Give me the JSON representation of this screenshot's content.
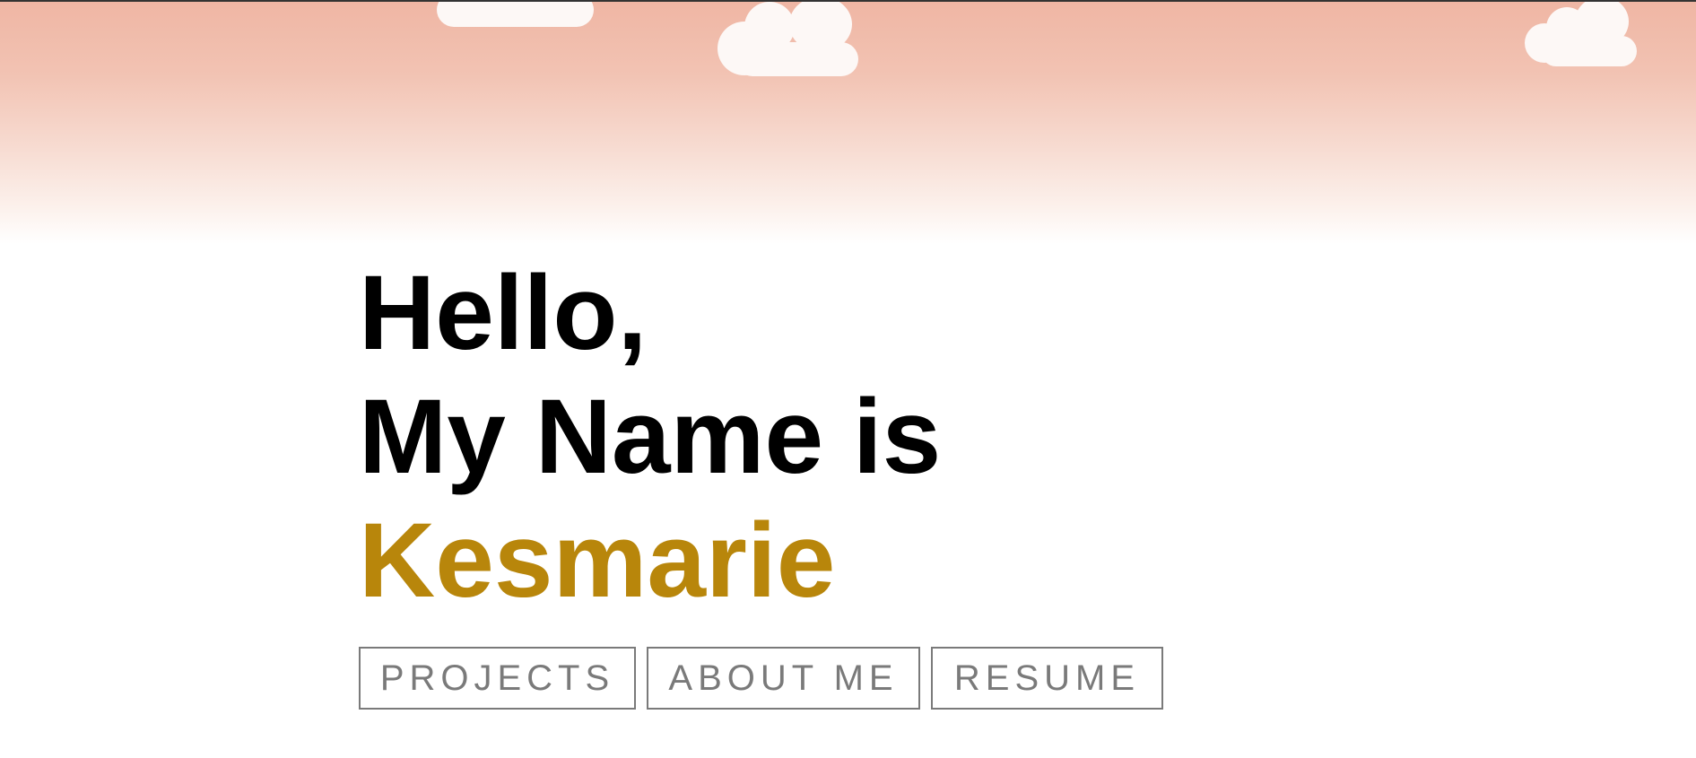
{
  "colors": {
    "sky_top": "#efb6a4",
    "sky_bottom": "#ffffff",
    "cloud": "#fdf8f6",
    "heading": "#000000",
    "name_accent": "#b8860b",
    "button_border": "#7a7a7a",
    "button_text": "#7a7a7a"
  },
  "hero": {
    "line1": "Hello,",
    "line2": "My Name is",
    "name": "Kesmarie"
  },
  "nav": {
    "projects_label": "PROJECTS",
    "about_label": "ABOUT ME",
    "resume_label": "RESUME"
  },
  "decor": {
    "cloud_icon": "cloud-icon"
  }
}
